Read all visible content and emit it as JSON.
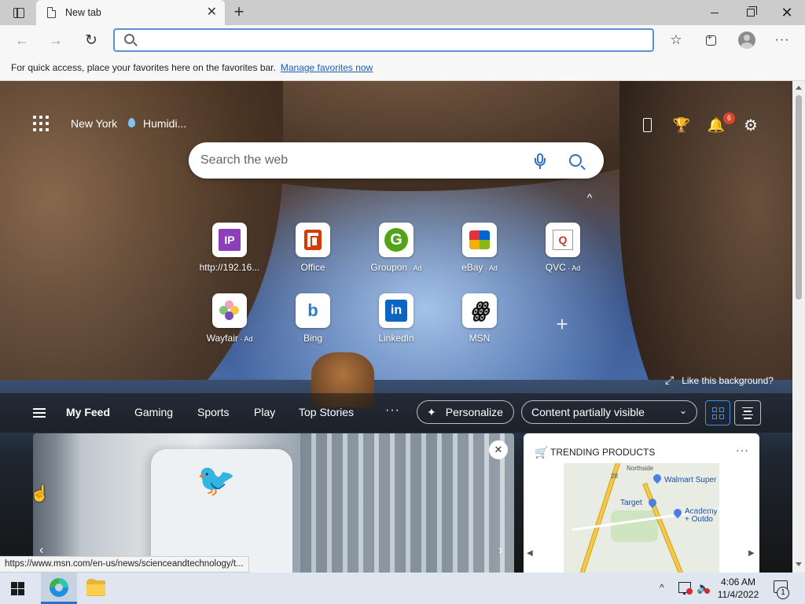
{
  "browser": {
    "tab_title": "New tab",
    "tab_close": "✕",
    "new_tab": "+",
    "address_value": "",
    "address_placeholder": "",
    "favbar_text": "For quick access, place your favorites here on the favorites bar.",
    "favbar_link": "Manage favorites now",
    "window_close": "✕",
    "menu": "···",
    "back": "←",
    "forward": "→",
    "refresh": "↻",
    "fav_add": "☆"
  },
  "newtab": {
    "location": "New York",
    "weather": "Humidi...",
    "notification_count": "6",
    "rewards": "🏆",
    "bell": "🔔",
    "settings": "⚙",
    "search_placeholder": "Search the web",
    "collapse": "^",
    "add_tile": "+",
    "like_background": "Like this background?",
    "expand": "⤢"
  },
  "tiles": [
    {
      "label": "http://192.16...",
      "ad": "",
      "logo": "IP"
    },
    {
      "label": "Office",
      "ad": ""
    },
    {
      "label": "Groupon",
      "ad": " · Ad",
      "logo": "G"
    },
    {
      "label": "eBay",
      "ad": " · Ad"
    },
    {
      "label": "QVC",
      "ad": " · Ad",
      "logo": "Q"
    },
    {
      "label": "Wayfair",
      "ad": " · Ad"
    },
    {
      "label": "Bing",
      "ad": "",
      "logo": "b"
    },
    {
      "label": "LinkedIn",
      "ad": "",
      "logo": "in"
    },
    {
      "label": "MSN",
      "ad": "",
      "logo": "ꙮ"
    }
  ],
  "feed": {
    "tabs": [
      "My Feed",
      "Gaming",
      "Sports",
      "Play",
      "Top Stories"
    ],
    "more": "···",
    "personalize": "Personalize",
    "spark": "✦",
    "content_visibility": "Content partially visible",
    "caret": "⌄",
    "hero_close": "✕",
    "hero_prev": "‹",
    "hero_next": "›",
    "bird": "🐦",
    "trending_title": "TRENDING PRODUCTS",
    "trending_more": "···",
    "trending_prev": "◀",
    "trending_next": "▶",
    "cart": "🛒",
    "map_labels": {
      "walmart": "Walmart Super",
      "target": "Target",
      "academy": "Academy",
      "academy2": "+ Outdo",
      "north": "Northside",
      "road": "28"
    }
  },
  "status_url": "https://www.msn.com/en-us/news/scienceandtechnology/t...",
  "taskbar": {
    "time": "4:06 AM",
    "date": "11/4/2022",
    "tray_up": "^",
    "volume": "🔈",
    "notif_count": "1"
  },
  "cursor": "☝"
}
